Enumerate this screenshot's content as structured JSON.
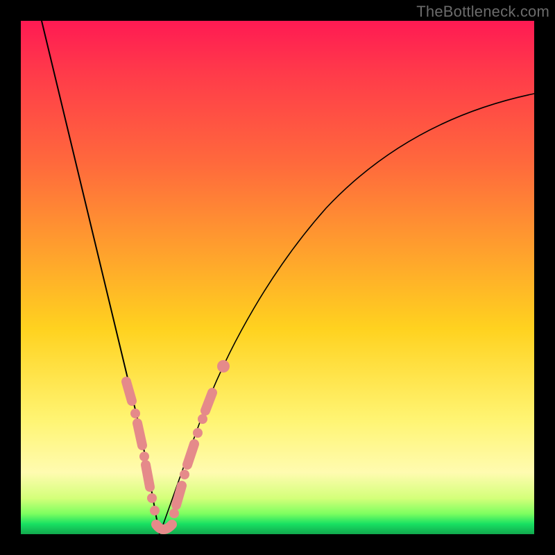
{
  "watermark": "TheBottleneck.com",
  "chart_data": {
    "type": "line",
    "title": "",
    "xlabel": "",
    "ylabel": "",
    "xlim": [
      0,
      100
    ],
    "ylim": [
      0,
      100
    ],
    "series": [
      {
        "name": "bottleneck-curve-left",
        "x": [
          4,
          8,
          12,
          16,
          20,
          22,
          24,
          25,
          26,
          27
        ],
        "y": [
          100,
          82,
          63,
          44,
          24,
          15,
          8,
          4,
          1,
          0
        ]
      },
      {
        "name": "bottleneck-curve-right",
        "x": [
          27,
          29,
          32,
          36,
          40,
          46,
          54,
          64,
          76,
          90,
          100
        ],
        "y": [
          0,
          4,
          12,
          23,
          33,
          45,
          56,
          66,
          75,
          82,
          86
        ]
      }
    ],
    "markers": {
      "name": "highlighted-range",
      "color": "#e58a8a",
      "points_left": [
        {
          "x": 20.5,
          "y": 28
        },
        {
          "x": 21.5,
          "y": 24
        },
        {
          "x": 22.7,
          "y": 18
        },
        {
          "x": 23.2,
          "y": 15
        },
        {
          "x": 24.1,
          "y": 11
        },
        {
          "x": 24.9,
          "y": 7
        },
        {
          "x": 25.6,
          "y": 4
        }
      ],
      "points_right": [
        {
          "x": 28.8,
          "y": 5
        },
        {
          "x": 29.6,
          "y": 8
        },
        {
          "x": 30.4,
          "y": 11
        },
        {
          "x": 31.2,
          "y": 14
        },
        {
          "x": 32.1,
          "y": 17
        },
        {
          "x": 33.0,
          "y": 20
        },
        {
          "x": 34.8,
          "y": 26
        },
        {
          "x": 36.3,
          "y": 30
        }
      ],
      "valley_floor": {
        "x0": 25.6,
        "x1": 28.8,
        "y": 1
      }
    },
    "gradient_stops": [
      {
        "pct": 0,
        "color": "#ff1a53"
      },
      {
        "pct": 45,
        "color": "#ffa12d"
      },
      {
        "pct": 78,
        "color": "#fff574"
      },
      {
        "pct": 96,
        "color": "#7eff60"
      },
      {
        "pct": 100,
        "color": "#12a84e"
      }
    ]
  }
}
